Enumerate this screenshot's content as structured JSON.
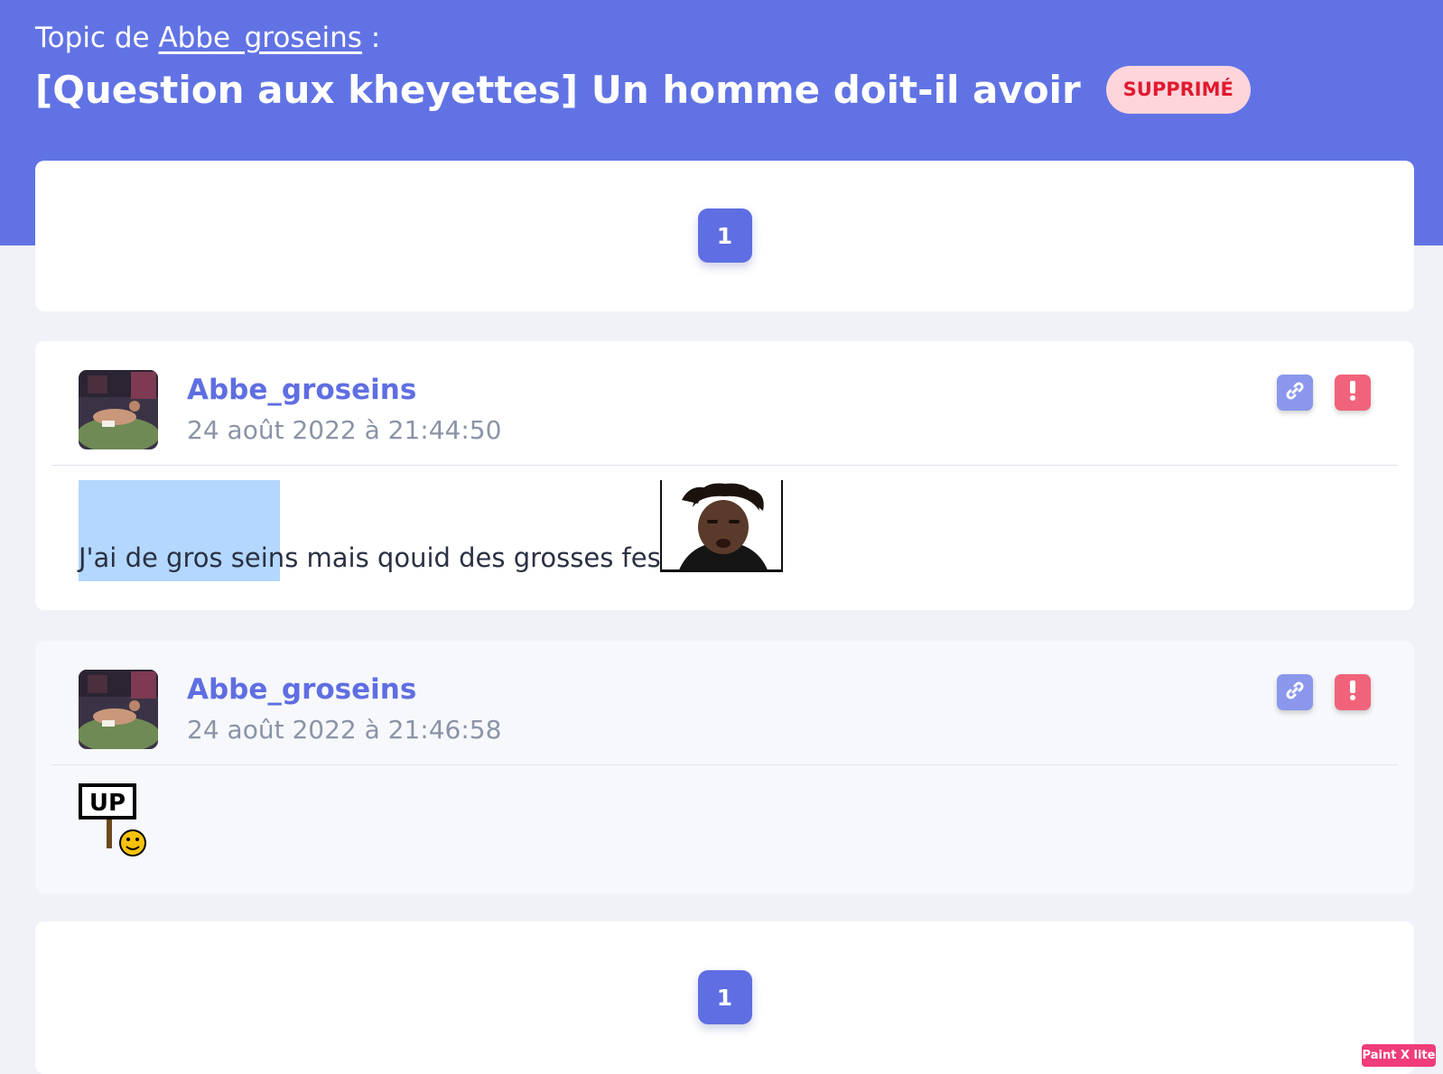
{
  "header": {
    "topic_prefix": "Topic de",
    "topic_author": "Abbe_groseins",
    "topic_suffix": ":",
    "title": "[Question aux kheyettes] Un homme doit-il avoir",
    "status_badge": "SUPPRIMÉ"
  },
  "pagination_top": {
    "pages": [
      "1"
    ],
    "current": "1"
  },
  "posts": [
    {
      "author": "Abbe_groseins",
      "date": "24 août 2022 à 21:44:50",
      "message_selected": "J'ai de gros seins",
      "message_rest": " mais qouid des grosses fesses ?",
      "sticker": "face-sticker"
    },
    {
      "author": "Abbe_groseins",
      "date": "24 août 2022 à 21:46:58",
      "sticker": "up-sign-smiley-sticker",
      "sticker_text": "UP"
    }
  ],
  "pagination_bottom": {
    "pages": [
      "1"
    ],
    "current": "1"
  },
  "watermark": "Paint X lite",
  "colors": {
    "accent": "#5f6ee2",
    "hero_bg": "#6173e4",
    "badge_bg": "#fdd5db",
    "badge_text": "#e1192f",
    "report": "#f1637b",
    "link": "#8a97ec"
  }
}
